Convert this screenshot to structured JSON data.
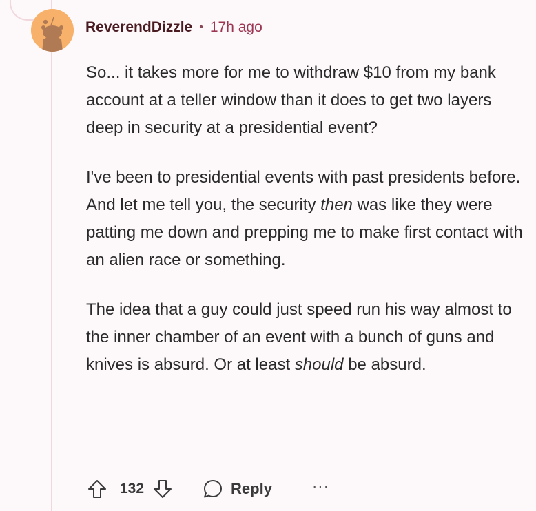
{
  "comment": {
    "author": "ReverendDizzle",
    "separator": "•",
    "timestamp": "17h ago",
    "avatar_color": "#f7b16a",
    "paragraphs": [
      {
        "segments": [
          {
            "text": "So... it takes more for me to withdraw $10 from my bank account at a teller window than it does to get two layers deep in security at a presidential event?",
            "italic": false
          }
        ]
      },
      {
        "segments": [
          {
            "text": "I've been to presidential events with past presidents before. And let me tell you, the security ",
            "italic": false
          },
          {
            "text": "then",
            "italic": true
          },
          {
            "text": " was like they were patting me down and prepping me to make first contact with an alien race or something.",
            "italic": false
          }
        ]
      },
      {
        "segments": [
          {
            "text": "The idea that a guy could just speed run his way almost to the inner chamber of an event with a bunch of guns and knives is absurd. Or at least ",
            "italic": false
          },
          {
            "text": "should",
            "italic": true
          },
          {
            "text": " be absurd.",
            "italic": false
          }
        ]
      }
    ],
    "actions": {
      "upvote_icon": "arrow-up-outline-icon",
      "vote_count": "132",
      "downvote_icon": "arrow-down-outline-icon",
      "reply_icon": "speech-bubble-icon",
      "reply_label": "Reply",
      "more_label": "···"
    }
  }
}
